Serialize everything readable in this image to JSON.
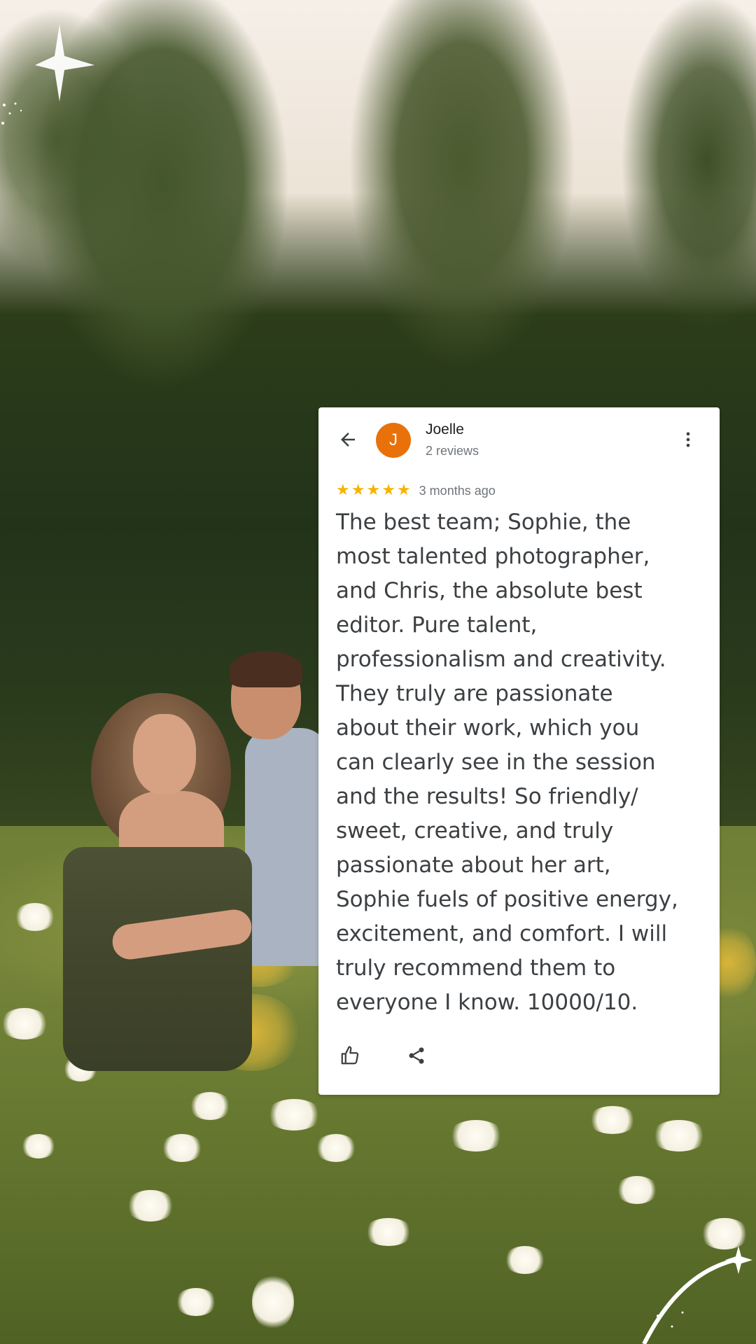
{
  "review": {
    "reviewer_name": "Joelle",
    "reviewer_initial": "J",
    "review_count": "2 reviews",
    "rating": 5,
    "stars": [
      "★",
      "★",
      "★",
      "★",
      "★"
    ],
    "time_ago": "3 months ago",
    "text": "The best team; Sophie, the\nmost talented photographer,\nand Chris, the absolute best\neditor. Pure talent,\nprofessionalism and creativity.\nThey truly are passionate\nabout their work, which you\ncan clearly see in the session\nand the results! So friendly/\nsweet, creative, and truly\npassionate about her art,\nSophie fuels of positive energy,\nexcitement, and comfort. I will\ntruly recommend them to\neveryone I know. 10000/10."
  },
  "icons": {
    "back": "back-arrow-icon",
    "more": "more-vertical-icon",
    "like": "thumbs-up-icon",
    "share": "share-icon"
  },
  "colors": {
    "avatar": "#e8710a",
    "star": "#f6b400",
    "card": "#ffffff",
    "text": "#3c4043",
    "muted": "#70757a"
  }
}
